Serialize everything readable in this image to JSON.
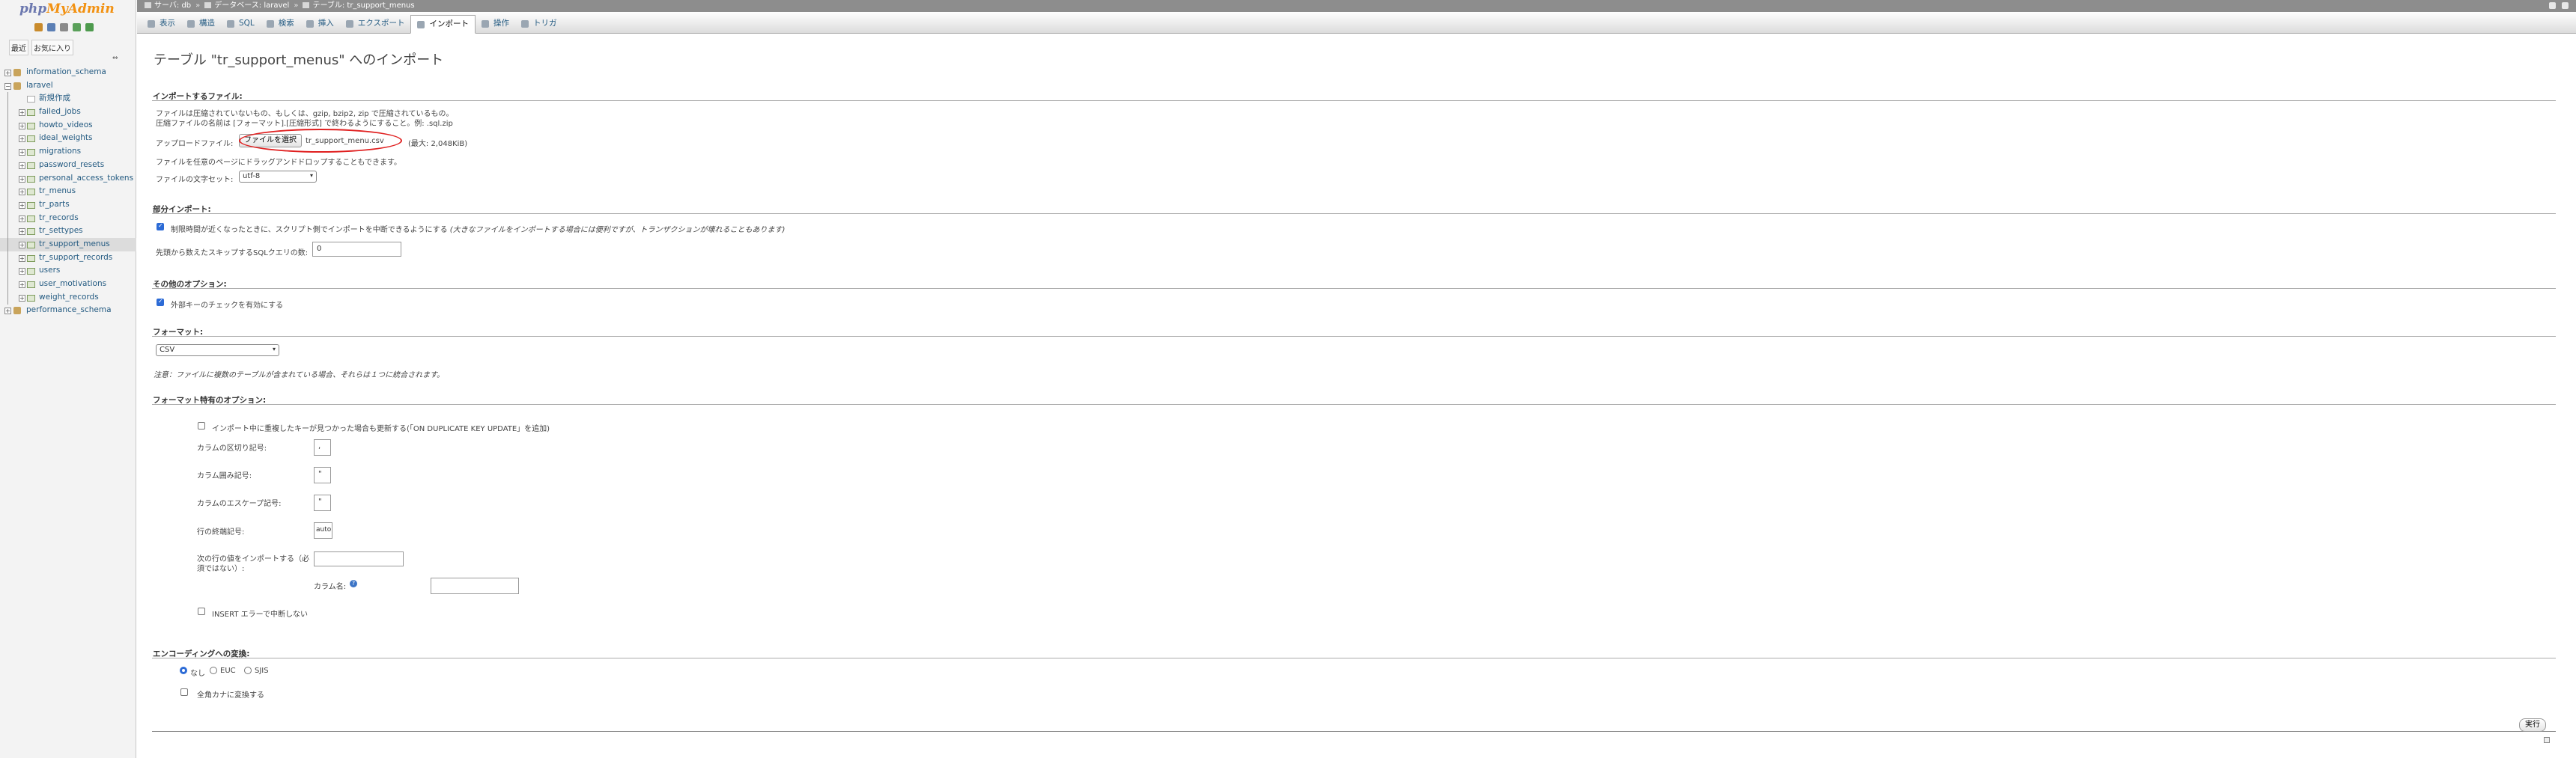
{
  "logo": {
    "php": "php",
    "myadmin": "MyAdmin"
  },
  "nav": {
    "tabs": [
      "最近",
      "お気に入り"
    ],
    "collapse": "⇔",
    "databases": [
      {
        "name": "information_schema",
        "expanded": false
      },
      {
        "name": "laravel",
        "expanded": true
      },
      {
        "name": "performance_schema",
        "expanded": false
      }
    ],
    "new_item": "新規作成",
    "tables": [
      "failed_jobs",
      "howto_videos",
      "ideal_weights",
      "migrations",
      "password_resets",
      "personal_access_tokens",
      "tr_menus",
      "tr_parts",
      "tr_records",
      "tr_settypes",
      "tr_support_menus",
      "tr_support_records",
      "users",
      "user_motivations",
      "weight_records"
    ],
    "active_table": "tr_support_menus"
  },
  "breadcrumb": {
    "server": "サーバ: db",
    "database": "データベース: laravel",
    "table": "テーブル: tr_support_menus"
  },
  "tabs": [
    {
      "label": "表示",
      "active": false
    },
    {
      "label": "構造",
      "active": false
    },
    {
      "label": "SQL",
      "active": false
    },
    {
      "label": "検索",
      "active": false
    },
    {
      "label": "挿入",
      "active": false
    },
    {
      "label": "エクスポート",
      "active": false
    },
    {
      "label": "インポート",
      "active": true
    },
    {
      "label": "操作",
      "active": false
    },
    {
      "label": "トリガ",
      "active": false
    }
  ],
  "page": {
    "title": "テーブル \"tr_support_menus\" へのインポート",
    "file_section": {
      "legend": "インポートするファイル:",
      "line1": "ファイルは圧縮されていないもの、もしくは、gzip, bzip2, zip で圧縮されているもの。",
      "line2": "圧縮ファイルの名前は [フォーマット].[圧縮形式] で終わるようにすること。例: .sql.zip",
      "upload_label": "アップロードファイル:",
      "choose_button": "ファイルを選択",
      "file_name": "tr_support_menu.csv",
      "max_size": "(最大: 2,048KiB)",
      "drag_note": "ファイルを任意のページにドラッグアンドドロップすることもできます。",
      "charset_label": "ファイルの文字セット:",
      "charset_value": "utf-8"
    },
    "partial_section": {
      "legend": "部分インポート:",
      "allow_interrupt_label": "制限時間が近くなったときに、スクリプト側でインポートを中断できるようにする",
      "allow_interrupt_note": "(大きなファイルをインポートする場合には便利ですが、トランザクションが壊れることもあります)",
      "allow_interrupt_checked": true,
      "skip_label": "先頭から数えたスキップするSQLクエリの数:",
      "skip_value": "0"
    },
    "other_section": {
      "legend": "その他のオプション:",
      "fk_label": "外部キーのチェックを有効にする",
      "fk_checked": true
    },
    "format_section": {
      "legend": "フォーマット:",
      "value": "CSV",
      "note": "注意：ファイルに複数のテーブルが含まれている場合、それらは１つに統合されます。"
    },
    "format_options": {
      "legend": "フォーマット特有のオプション:",
      "duplicate_label": "インポート中に重複したキーが見つかった場合も更新する(「ON DUPLICATE KEY UPDATE」を追加)",
      "duplicate_checked": false,
      "col_sep_label": "カラムの区切り記号:",
      "col_sep_value": ",",
      "col_enc_label": "カラム囲み記号:",
      "col_enc_value": "\"",
      "col_esc_label": "カラムのエスケープ記号:",
      "col_esc_value": "\"",
      "line_term_label": "行の終端記号:",
      "line_term_value": "auto",
      "col_names_label_1": "次の行の値をインポートする（必",
      "col_names_label_2": "須ではない）:",
      "col_names_value": "",
      "col_name_label": "カラム名:",
      "col_name_value": "",
      "no_abort_label": "INSERT エラーで中断しない",
      "no_abort_checked": false
    },
    "encoding_section": {
      "legend": "エンコーディングへの変換:",
      "options": [
        "なし",
        "EUC",
        "SJIS"
      ],
      "selected": "なし",
      "zenkaku_label": "全角カナに変換する",
      "zenkaku_checked": false
    },
    "execute_button": "実行"
  },
  "colors": {
    "accent": "#235a81",
    "highlight_ellipse": "#e02020",
    "logo_orange": "#f29111",
    "logo_blue": "#6c78af"
  }
}
